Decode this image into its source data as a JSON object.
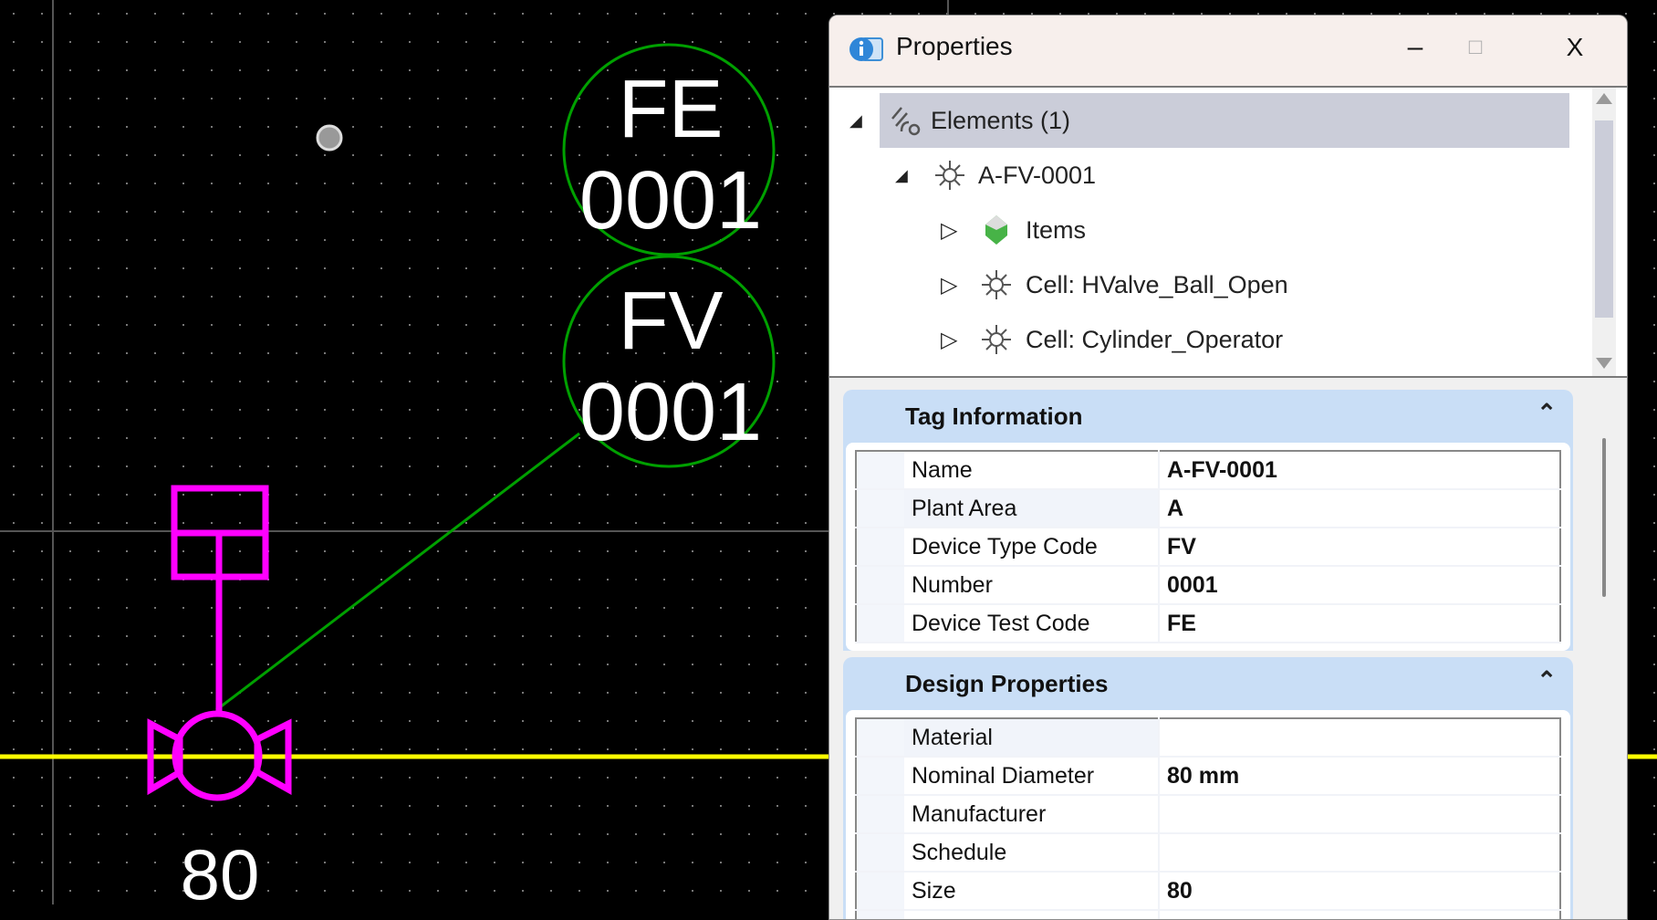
{
  "canvas": {
    "tags": [
      {
        "code": "FE",
        "number": "0001"
      },
      {
        "code": "FV",
        "number": "0001"
      }
    ],
    "valve_size_label": "80",
    "colors": {
      "background": "#000000",
      "tag_circle": "#00a000",
      "leader": "#00a000",
      "valve": "#ff00ff",
      "pipe": "#ffff00",
      "grid": "#888888"
    }
  },
  "window": {
    "title": "Properties",
    "minimize": "–",
    "maximize": "□",
    "close": "X"
  },
  "tree": {
    "items": [
      {
        "label": "Elements (1)",
        "icon": "elements-icon",
        "expander": "◢",
        "level": 0,
        "selected": true
      },
      {
        "label": "A-FV-0001",
        "icon": "cell-icon",
        "expander": "◢",
        "level": 1
      },
      {
        "label": "Items",
        "icon": "items-gem-icon",
        "expander": "▷",
        "level": 2
      },
      {
        "label": "Cell: HValve_Ball_Open",
        "icon": "cell-icon",
        "expander": "▷",
        "level": 2
      },
      {
        "label": "Cell: Cylinder_Operator",
        "icon": "cell-icon",
        "expander": "▷",
        "level": 2
      }
    ]
  },
  "groups": [
    {
      "title": "Tag Information",
      "rows": [
        {
          "key": "Name",
          "value": "A-FV-0001"
        },
        {
          "key": "Plant Area",
          "value": "A"
        },
        {
          "key": "Device Type Code",
          "value": "FV"
        },
        {
          "key": "Number",
          "value": "0001"
        },
        {
          "key": "Device Test Code",
          "value": "FE"
        }
      ]
    },
    {
      "title": "Design Properties",
      "rows": [
        {
          "key": "Material",
          "value": ""
        },
        {
          "key": "Nominal Diameter",
          "value": "80 mm"
        },
        {
          "key": "Manufacturer",
          "value": ""
        },
        {
          "key": "Schedule",
          "value": ""
        },
        {
          "key": "Size",
          "value": "80"
        },
        {
          "key": "",
          "value": ""
        }
      ]
    }
  ],
  "collapse_glyph": "⌃"
}
